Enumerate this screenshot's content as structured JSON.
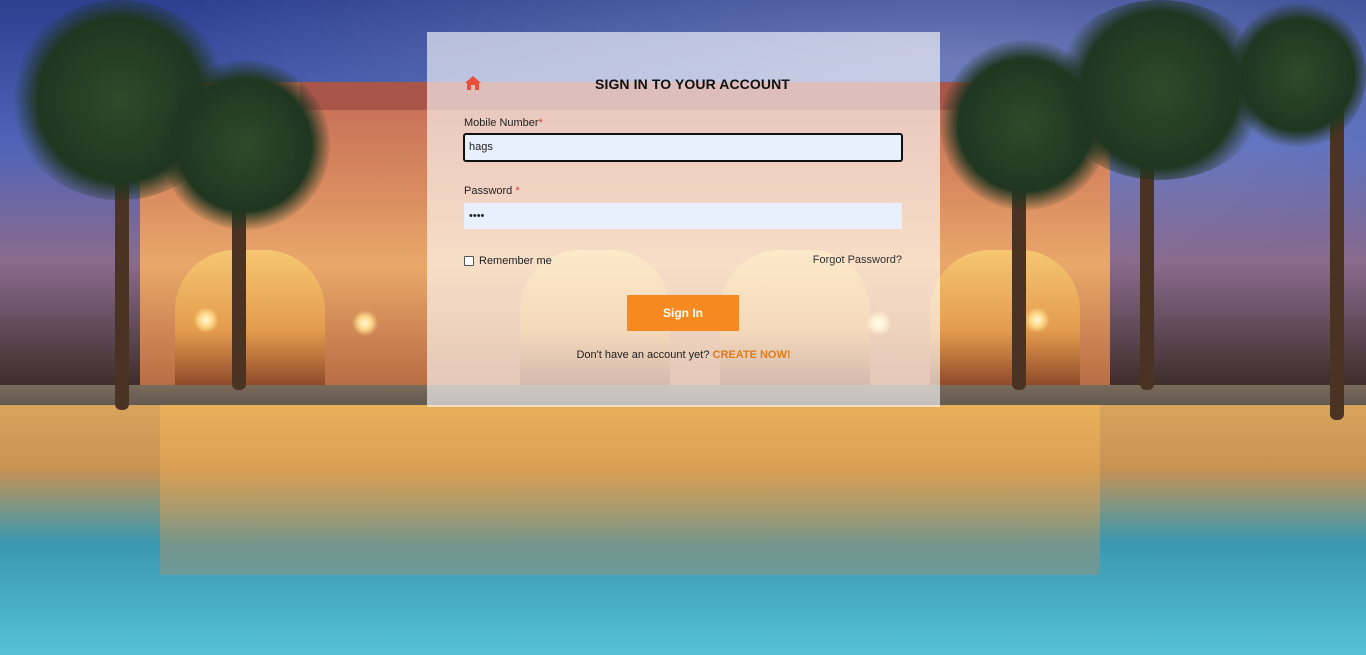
{
  "form": {
    "title": "SIGN IN TO YOUR ACCOUNT",
    "home_icon": "home-icon",
    "mobile_label": "Mobile Number",
    "mobile_required_mark": "*",
    "mobile_value": "hags",
    "password_label": "Password ",
    "password_required_mark": "*",
    "password_value": "••••",
    "remember_label": "Remember me",
    "forgot_label": "Forgot Password?",
    "signin_label": "Sign In",
    "signup_prompt": "Don't have an account yet? ",
    "signup_link": "CREATE NOW!"
  },
  "colors": {
    "accent": "#f6891f",
    "required": "#e03b2e",
    "link": "#e07a1a",
    "input_bg": "#e8f0fe"
  }
}
